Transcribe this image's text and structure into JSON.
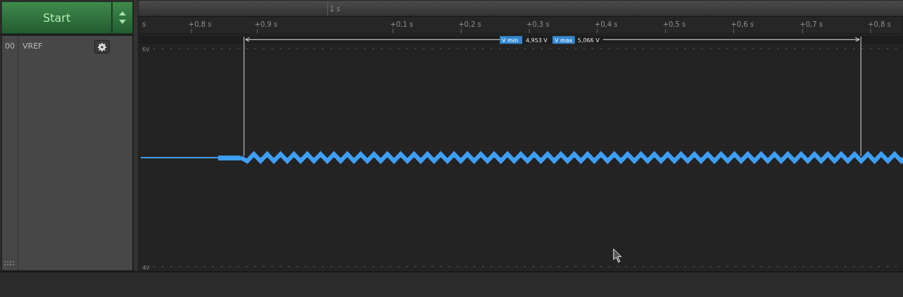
{
  "start_button": {
    "label": "Start"
  },
  "channel": {
    "number": "00",
    "name": "VREF"
  },
  "ruler": {
    "major_label": "1 s",
    "left_edge_label": "s",
    "ticks": [
      "+0,8 s",
      "+0,9 s",
      "+0,1 s",
      "+0,2 s",
      "+0,3 s",
      "+0,4 s",
      "+0,5 s",
      "+0,6 s",
      "+0,7 s",
      "+0,8 s"
    ]
  },
  "measurement": {
    "min_label": "V min",
    "min_value": "4,953 V",
    "max_label": "V max",
    "max_value": "5,066 V"
  },
  "y_axis": {
    "top_label": "6V",
    "bottom_label": "4V"
  }
}
